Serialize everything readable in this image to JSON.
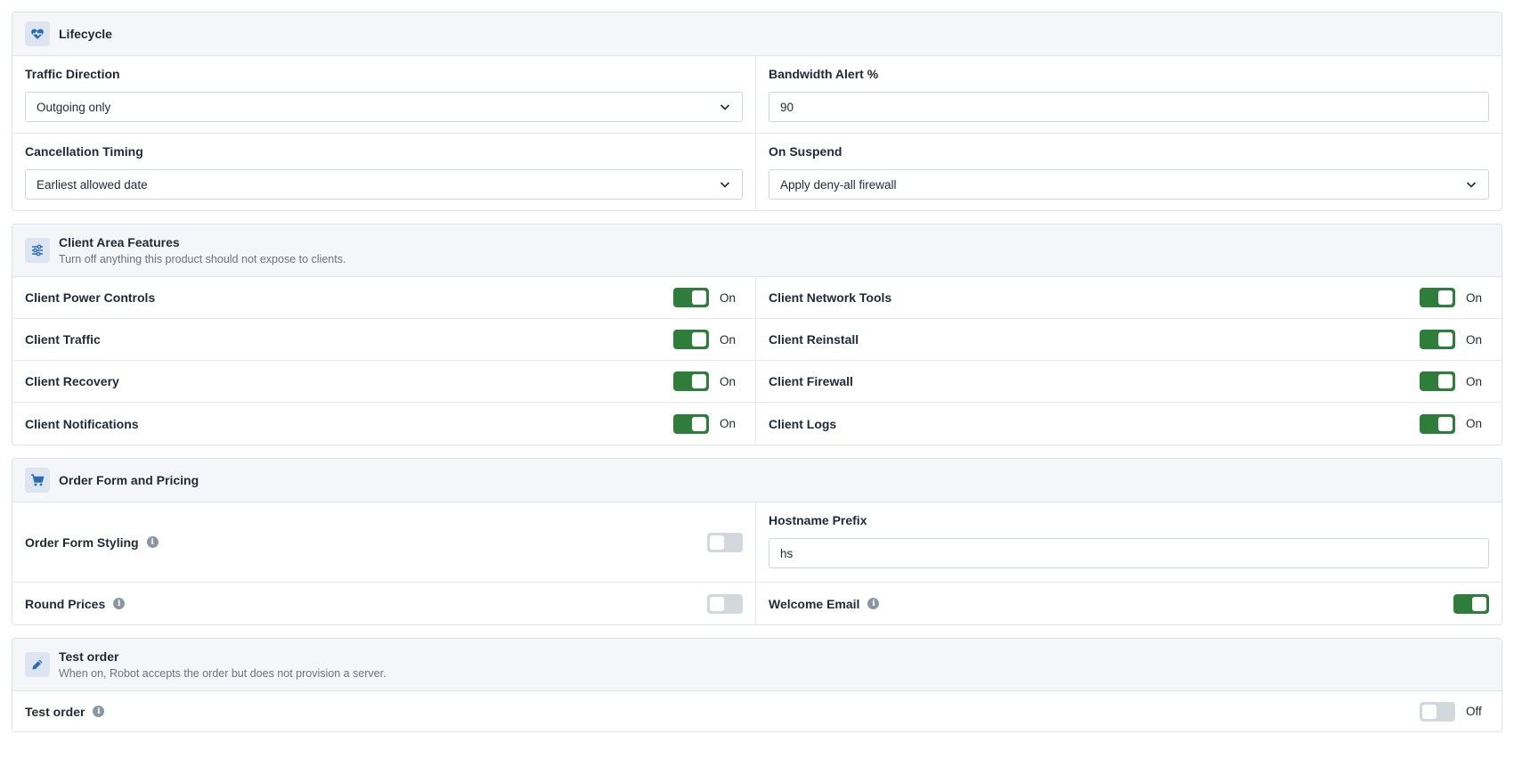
{
  "lifecycle": {
    "title": "Lifecycle",
    "icon": "heart-pulse-icon",
    "traffic_direction": {
      "label": "Traffic Direction",
      "value": "Outgoing only"
    },
    "bandwidth_alert": {
      "label": "Bandwidth Alert %",
      "value": "90"
    },
    "cancellation_timing": {
      "label": "Cancellation Timing",
      "value": "Earliest allowed date"
    },
    "on_suspend": {
      "label": "On Suspend",
      "value": "Apply deny-all firewall"
    }
  },
  "client_area": {
    "title": "Client Area Features",
    "subtitle": "Turn off anything this product should not expose to clients.",
    "icon": "sliders-icon",
    "items": [
      {
        "label": "Client Power Controls",
        "state": "On"
      },
      {
        "label": "Client Network Tools",
        "state": "On"
      },
      {
        "label": "Client Traffic",
        "state": "On"
      },
      {
        "label": "Client Reinstall",
        "state": "On"
      },
      {
        "label": "Client Recovery",
        "state": "On"
      },
      {
        "label": "Client Firewall",
        "state": "On"
      },
      {
        "label": "Client Notifications",
        "state": "On"
      },
      {
        "label": "Client Logs",
        "state": "On"
      }
    ]
  },
  "order_form": {
    "title": "Order Form and Pricing",
    "icon": "cart-icon",
    "order_form_styling": {
      "label": "Order Form Styling",
      "enabled": false
    },
    "hostname_prefix": {
      "label": "Hostname Prefix",
      "value": "hs"
    },
    "round_prices": {
      "label": "Round Prices",
      "enabled": false
    },
    "welcome_email": {
      "label": "Welcome Email",
      "enabled": true
    }
  },
  "test_order": {
    "title": "Test order",
    "subtitle": "When on, Robot accepts the order but does not provision a server.",
    "icon": "pencil-icon",
    "row": {
      "label": "Test order",
      "state": "Off"
    }
  },
  "colors": {
    "toggle_on": "#2f7d3b",
    "toggle_off": "#d3d8de",
    "header_bg": "#f4f6f9",
    "icon_accent": "#2b6cb0"
  }
}
